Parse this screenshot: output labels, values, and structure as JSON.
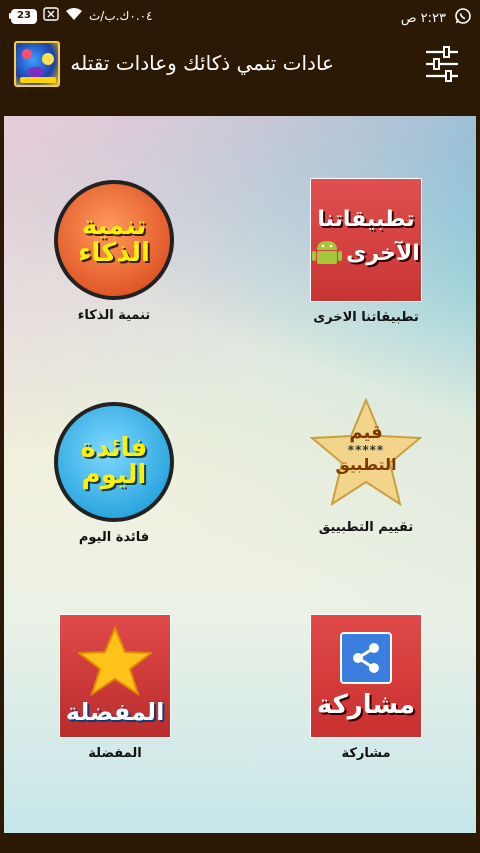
{
  "status_bar": {
    "battery": "23",
    "network_speed": "٠.٠٤ك.ب/ث",
    "time": "٢:٢٣ ص"
  },
  "app_bar": {
    "title": "عادات تنمي ذكائك وعادات تقتله"
  },
  "tiles": [
    {
      "label": "تطبيقاتنا الاخرى",
      "art_line1": "تطبيقاتنا",
      "art_line2": "الآخرى"
    },
    {
      "label": "تنمية الذكاء",
      "art_line1": "تنمية",
      "art_line2": "الذكاء"
    },
    {
      "label": "تقييم التطبييق",
      "art_line1": "قيم",
      "art_stars": "*****",
      "art_line2": "التطبيق"
    },
    {
      "label": "فائدة اليوم",
      "art_line1": "فائدة",
      "art_line2": "اليوم"
    },
    {
      "label": "مشاركة",
      "art_line1": "مشاركة"
    },
    {
      "label": "المفضلة",
      "art_line1": "المفضلة"
    }
  ],
  "colors": {
    "bar_bg": "#2b1905",
    "orange_circle": "#e8683a",
    "blue_circle": "#3cb8e8",
    "red_tile": "#d83a3a",
    "share_blue": "#3a7ee0"
  }
}
